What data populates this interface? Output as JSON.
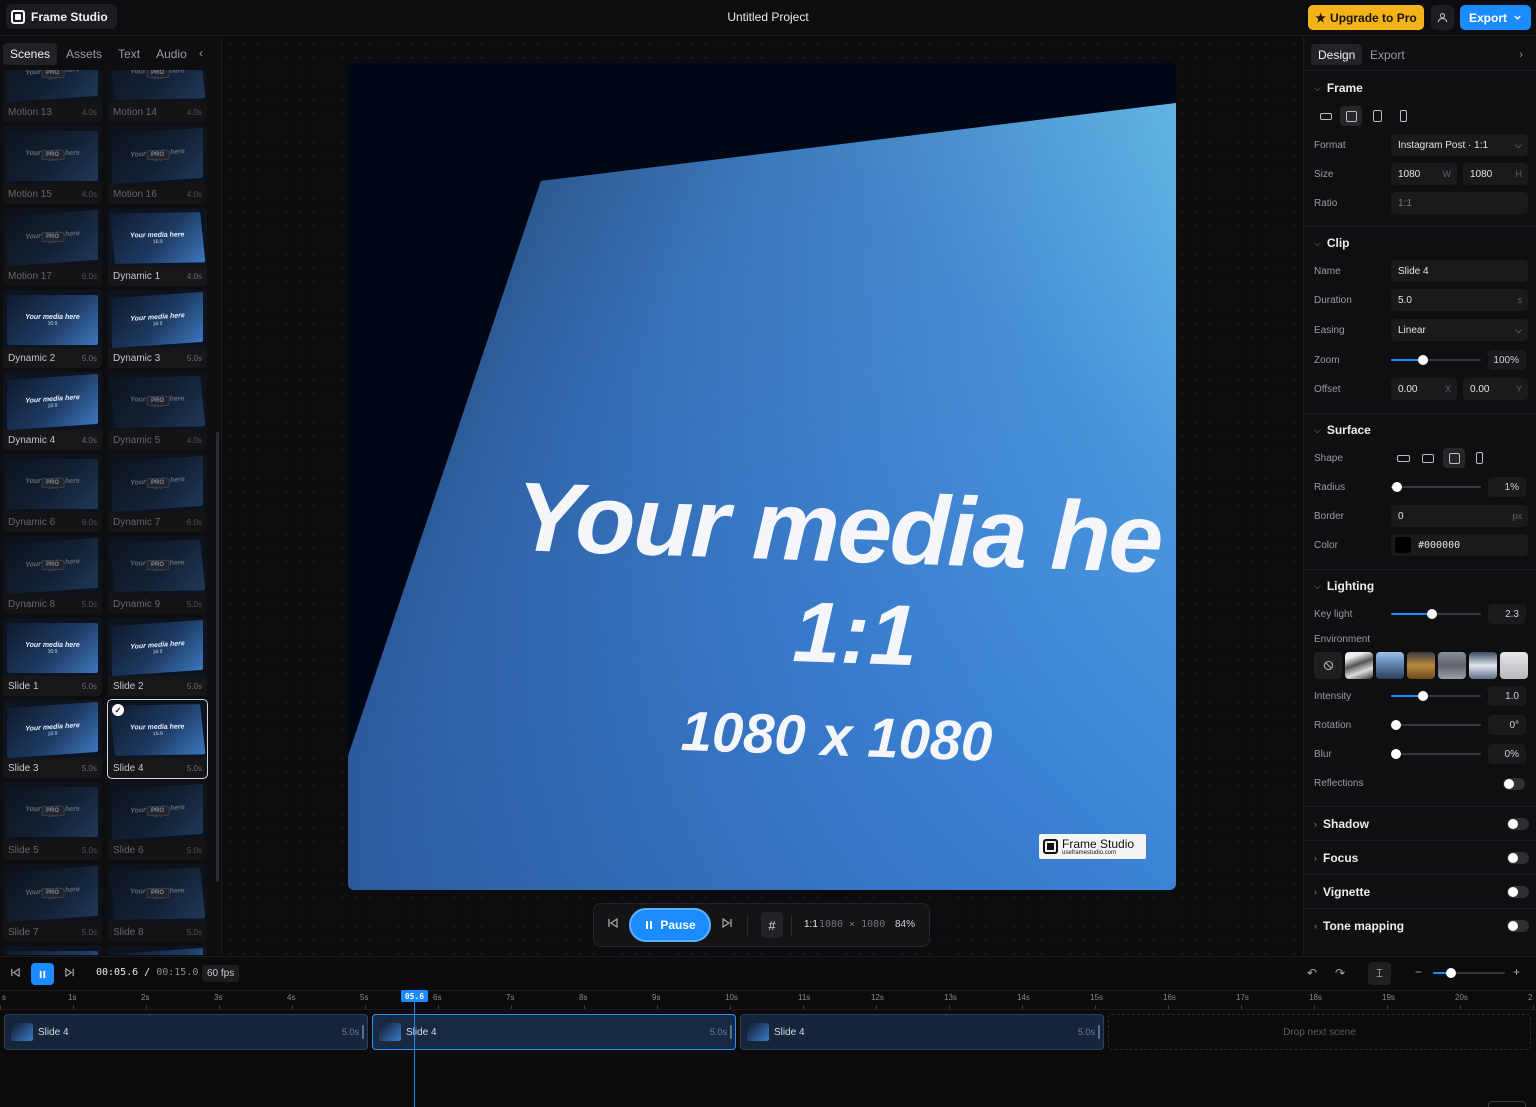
{
  "app": {
    "name": "Frame Studio",
    "project_title": "Untitled Project"
  },
  "topbar": {
    "upgrade_label": "Upgrade to Pro",
    "export_label": "Export"
  },
  "left_tabs": [
    "Scenes",
    "Assets",
    "Text",
    "Audio"
  ],
  "scenes": [
    {
      "label": "Motion 13",
      "duration": "4.0s",
      "locked": true
    },
    {
      "label": "Motion 14",
      "duration": "4.0s",
      "locked": true
    },
    {
      "label": "Motion 15",
      "duration": "4.0s",
      "locked": true
    },
    {
      "label": "Motion 16",
      "duration": "4.0s",
      "locked": true
    },
    {
      "label": "Motion 17",
      "duration": "6.0s",
      "locked": true
    },
    {
      "label": "Dynamic 1",
      "duration": "4.0s",
      "locked": false
    },
    {
      "label": "Dynamic 2",
      "duration": "5.0s",
      "locked": false
    },
    {
      "label": "Dynamic 3",
      "duration": "5.0s",
      "locked": false
    },
    {
      "label": "Dynamic 4",
      "duration": "4.0s",
      "locked": false
    },
    {
      "label": "Dynamic 5",
      "duration": "4.0s",
      "locked": true
    },
    {
      "label": "Dynamic 6",
      "duration": "6.0s",
      "locked": true
    },
    {
      "label": "Dynamic 7",
      "duration": "6.0s",
      "locked": true
    },
    {
      "label": "Dynamic 8",
      "duration": "5.0s",
      "locked": true
    },
    {
      "label": "Dynamic 9",
      "duration": "5.0s",
      "locked": true
    },
    {
      "label": "Slide 1",
      "duration": "5.0s",
      "locked": false
    },
    {
      "label": "Slide 2",
      "duration": "5.0s",
      "locked": false
    },
    {
      "label": "Slide 3",
      "duration": "5.0s",
      "locked": false
    },
    {
      "label": "Slide 4",
      "duration": "5.0s",
      "locked": false,
      "selected": true
    },
    {
      "label": "Slide 5",
      "duration": "5.0s",
      "locked": true
    },
    {
      "label": "Slide 6",
      "duration": "5.0s",
      "locked": true
    },
    {
      "label": "Slide 7",
      "duration": "5.0s",
      "locked": true
    },
    {
      "label": "Slide 8",
      "duration": "5.0s",
      "locked": true
    },
    {
      "label": "",
      "duration": "",
      "locked": false
    },
    {
      "label": "",
      "duration": "",
      "locked": false
    }
  ],
  "thumb_text": {
    "media": "Your media here",
    "ratio": "16:9",
    "pro": "PRO"
  },
  "canvas": {
    "media_text": "Your media he",
    "ratio_text": "1:1",
    "res_text": "1080 x 1080",
    "watermark_name": "Frame Studio",
    "watermark_url": "useframestudio.com"
  },
  "playbar": {
    "pause_label": "Pause",
    "ratio": "1:1",
    "dims": "1080 × 1080",
    "zoom": "84%"
  },
  "right_tabs": [
    "Design",
    "Export"
  ],
  "design": {
    "frame": {
      "title": "Frame",
      "format_label": "Format",
      "format_value": "Instagram Post · 1:1",
      "size_label": "Size",
      "width": "1080",
      "width_unit": "W",
      "height": "1080",
      "height_unit": "H",
      "ratio_label": "Ratio",
      "ratio_value": "1:1"
    },
    "clip": {
      "title": "Clip",
      "name_label": "Name",
      "name_value": "Slide 4",
      "duration_label": "Duration",
      "duration_value": "5.0",
      "duration_unit": "s",
      "easing_label": "Easing",
      "easing_value": "Linear",
      "zoom_label": "Zoom",
      "zoom_value": "100%",
      "zoom_level": 0.35,
      "offset_label": "Offset",
      "offset_x": "0.00",
      "offset_x_unit": "X",
      "offset_y": "0.00",
      "offset_y_unit": "Y"
    },
    "surface": {
      "title": "Surface",
      "shape_label": "Shape",
      "radius_label": "Radius",
      "radius_value": "1%",
      "radius_level": 0.07,
      "border_label": "Border",
      "border_value": "0",
      "border_unit": "px",
      "color_label": "Color",
      "color_value": "#000000"
    },
    "lighting": {
      "title": "Lighting",
      "keylight_label": "Key light",
      "keylight_value": "2.3",
      "keylight_level": 0.46,
      "environment_label": "Environment",
      "intensity_label": "Intensity",
      "intensity_value": "1.0",
      "intensity_level": 0.35,
      "rotation_label": "Rotation",
      "rotation_value": "0°",
      "rotation_level": 0.05,
      "blur_label": "Blur",
      "blur_value": "0%",
      "blur_level": 0.05,
      "reflections_label": "Reflections"
    },
    "collapsed": [
      "Shadow",
      "Focus",
      "Vignette",
      "Tone mapping"
    ]
  },
  "timeline": {
    "current": "00:05.6",
    "total": "00:15.0",
    "fps": "60 fps",
    "playhead_label": "05.6",
    "ticks": [
      "s",
      "1s",
      "2s",
      "3s",
      "4s",
      "5s",
      "6s",
      "7s",
      "8s",
      "9s",
      "10s",
      "11s",
      "12s",
      "13s",
      "14s",
      "15s",
      "16s",
      "17s",
      "18s",
      "19s",
      "20s",
      "2"
    ],
    "clips": [
      {
        "name": "Slide 4",
        "duration": "5.0s"
      },
      {
        "name": "Slide 4",
        "duration": "5.0s"
      },
      {
        "name": "Slide 4",
        "duration": "5.0s"
      }
    ],
    "drop_label": "Drop next scene",
    "zoom_level": 0.25
  },
  "colors": {
    "accent": "#1a8cff",
    "upgrade": "#f2b418"
  }
}
